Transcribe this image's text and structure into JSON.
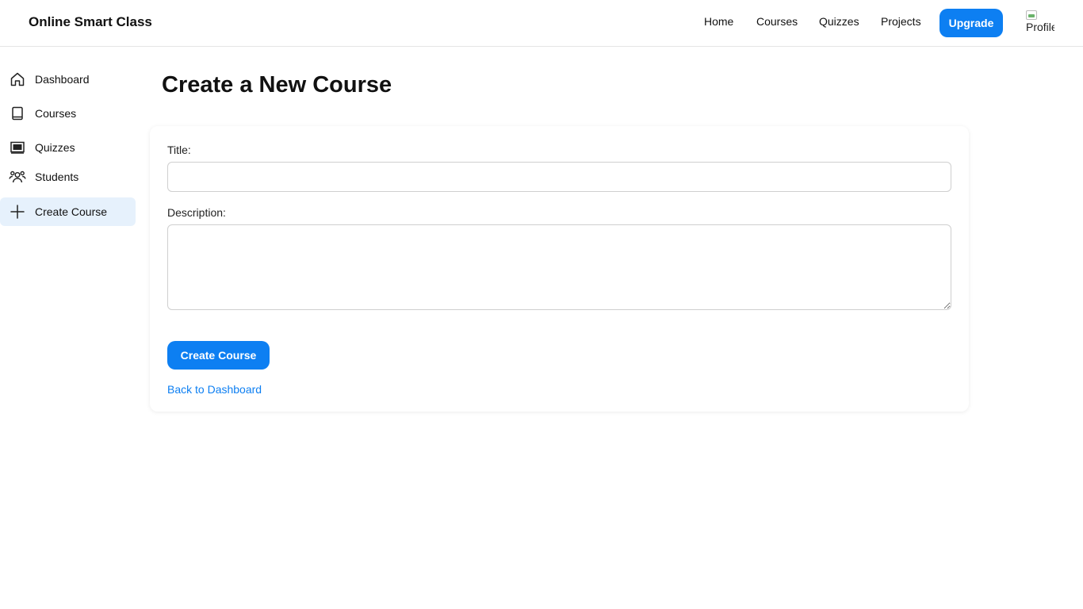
{
  "header": {
    "brand": "Online Smart Class",
    "nav": [
      {
        "label": "Home"
      },
      {
        "label": "Courses"
      },
      {
        "label": "Quizzes"
      },
      {
        "label": "Projects"
      }
    ],
    "upgrade_label": "Upgrade",
    "avatar_alt": "Profile"
  },
  "sidebar": {
    "items": [
      {
        "label": "Dashboard",
        "icon": "home-icon"
      },
      {
        "label": "Courses",
        "icon": "book-icon"
      },
      {
        "label": "Quizzes",
        "icon": "chalkboard-icon"
      },
      {
        "label": "Students",
        "icon": "users-icon"
      },
      {
        "label": "Create Course",
        "icon": "plus-icon",
        "active": true
      }
    ]
  },
  "main": {
    "page_title": "Create a New Course",
    "form": {
      "title_label": "Title:",
      "title_value": "",
      "description_label": "Description:",
      "description_value": "",
      "submit_label": "Create Course",
      "back_link": "Back to Dashboard"
    }
  },
  "colors": {
    "accent": "#0d7ff2",
    "active_item_bg": "#e6f1fc"
  }
}
